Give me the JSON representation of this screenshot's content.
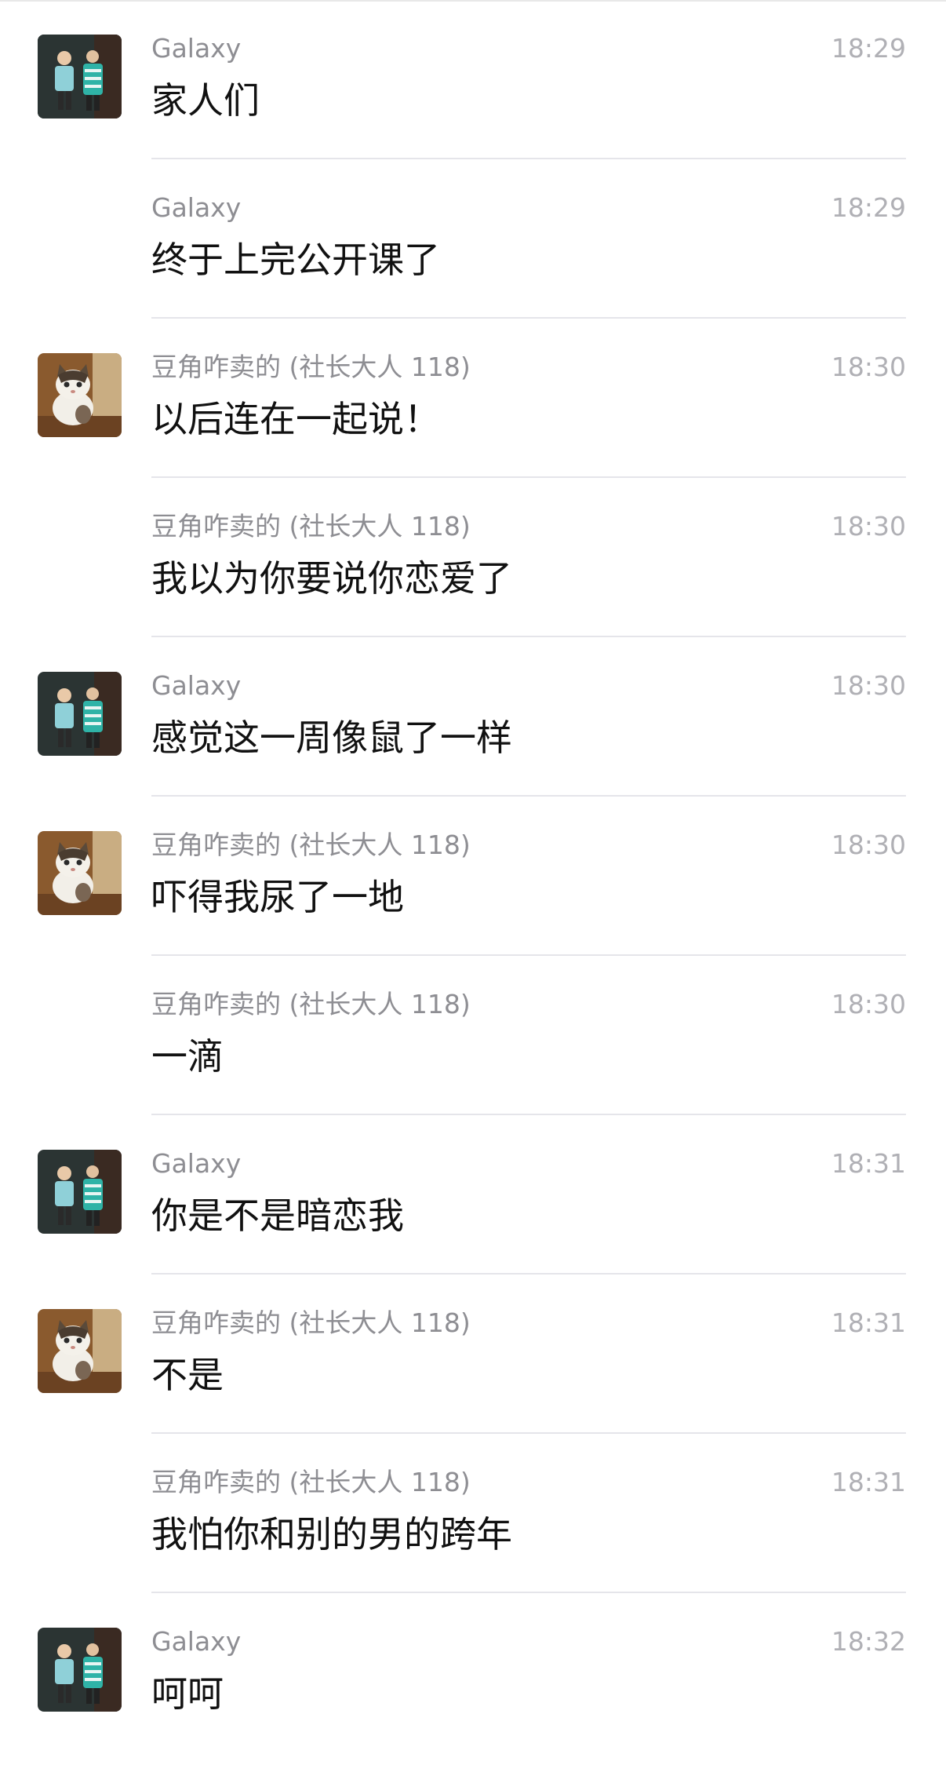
{
  "messages": [
    {
      "sender": "Galaxy",
      "time": "18:29",
      "text": "家人们",
      "avatar": "galaxy-avatar"
    },
    {
      "sender": "Galaxy",
      "time": "18:29",
      "text": "终于上完公开课了",
      "avatar": null
    },
    {
      "sender": "豆角咋卖的 (社长大人 118)",
      "time": "18:30",
      "text": "以后连在一起说！",
      "avatar": "cat-avatar"
    },
    {
      "sender": "豆角咋卖的 (社长大人 118)",
      "time": "18:30",
      "text": "我以为你要说你恋爱了",
      "avatar": null
    },
    {
      "sender": "Galaxy",
      "time": "18:30",
      "text": "感觉这一周像鼠了一样",
      "avatar": "galaxy-avatar"
    },
    {
      "sender": "豆角咋卖的 (社长大人 118)",
      "time": "18:30",
      "text": "吓得我尿了一地",
      "avatar": "cat-avatar"
    },
    {
      "sender": "豆角咋卖的 (社长大人 118)",
      "time": "18:30",
      "text": "一滴",
      "avatar": null
    },
    {
      "sender": "Galaxy",
      "time": "18:31",
      "text": "你是不是暗恋我",
      "avatar": "galaxy-avatar"
    },
    {
      "sender": "豆角咋卖的 (社长大人 118)",
      "time": "18:31",
      "text": "不是",
      "avatar": "cat-avatar"
    },
    {
      "sender": "豆角咋卖的 (社长大人 118)",
      "time": "18:31",
      "text": "我怕你和别的男的跨年",
      "avatar": null
    },
    {
      "sender": "Galaxy",
      "time": "18:32",
      "text": "呵呵",
      "avatar": "galaxy-avatar"
    }
  ]
}
